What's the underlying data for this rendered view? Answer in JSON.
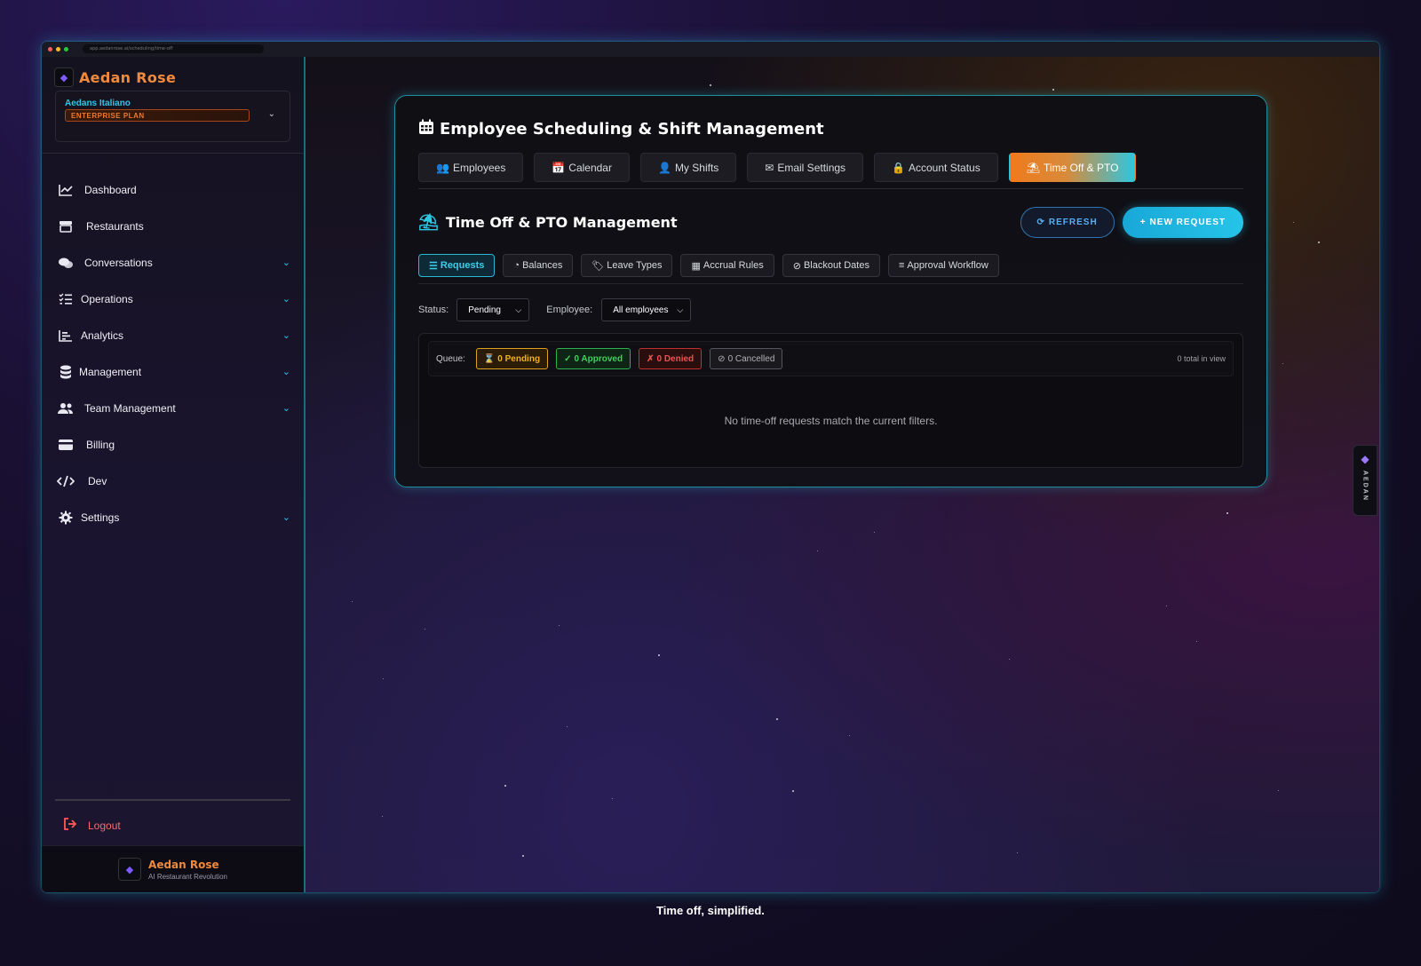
{
  "browser": {
    "url": "app.aedanrose.ai/scheduling/time-off"
  },
  "sidebar": {
    "brand": "Aedan Rose",
    "org_name": "Aedans Italiano",
    "plan": "ENTERPRISE PLAN",
    "items": [
      {
        "label": "Dashboard",
        "icon": "chart-line-icon",
        "has_children": false
      },
      {
        "label": "Restaurants",
        "icon": "store-icon",
        "has_children": false
      },
      {
        "label": "Conversations",
        "icon": "comments-icon",
        "has_children": true
      },
      {
        "label": "Operations",
        "icon": "list-check-icon",
        "has_children": true
      },
      {
        "label": "Analytics",
        "icon": "bar-chart-icon",
        "has_children": true
      },
      {
        "label": "Management",
        "icon": "database-icon",
        "has_children": true
      },
      {
        "label": "Team Management",
        "icon": "users-icon",
        "has_children": true
      },
      {
        "label": "Billing",
        "icon": "credit-card-icon",
        "has_children": false
      },
      {
        "label": "Dev",
        "icon": "code-icon",
        "has_children": false
      },
      {
        "label": "Settings",
        "icon": "gear-icon",
        "has_children": true
      }
    ],
    "logout": "Logout",
    "footer_name": "Aedan Rose",
    "footer_sub": "AI Restaurant Revolution"
  },
  "main": {
    "title": "Employee Scheduling & Shift Management",
    "tabs": [
      {
        "label": "Employees",
        "icon": "users-icon",
        "active": false
      },
      {
        "label": "Calendar",
        "icon": "calendar-icon",
        "active": false
      },
      {
        "label": "My Shifts",
        "icon": "user-clock-icon",
        "active": false
      },
      {
        "label": "Email Settings",
        "icon": "envelope-icon",
        "active": false
      },
      {
        "label": "Account Status",
        "icon": "lock-icon",
        "active": false
      },
      {
        "label": "Time Off & PTO",
        "icon": "umbrella-beach-icon",
        "active": true
      }
    ],
    "section_title": "Time Off & PTO Management",
    "refresh": "REFRESH",
    "new_request": "NEW REQUEST",
    "subtabs": [
      {
        "label": "Requests",
        "icon": "list-icon",
        "active": true
      },
      {
        "label": "Balances",
        "icon": "pie-chart-icon",
        "active": false
      },
      {
        "label": "Leave Types",
        "icon": "tag-icon",
        "active": false
      },
      {
        "label": "Accrual Rules",
        "icon": "calculator-icon",
        "active": false
      },
      {
        "label": "Blackout Dates",
        "icon": "ban-icon",
        "active": false
      },
      {
        "label": "Approval Workflow",
        "icon": "sliders-icon",
        "active": false
      }
    ],
    "filters": {
      "status_label": "Status:",
      "status_value": "Pending",
      "employee_label": "Employee:",
      "employee_value": "All employees"
    },
    "queue": {
      "label": "Queue:",
      "pending": "0 Pending",
      "approved": "0 Approved",
      "denied": "0 Denied",
      "cancelled": "0 Cancelled",
      "total": "0 total in view"
    },
    "empty_message": "No time-off requests match the current filters."
  },
  "side_tab": "AEDAN",
  "caption": "Time off, simplified.",
  "colors": {
    "accent_cyan": "#2ec6e8",
    "accent_orange": "#f07a1c",
    "pending": "#f0b020",
    "approved": "#40d060",
    "denied": "#f05050"
  }
}
